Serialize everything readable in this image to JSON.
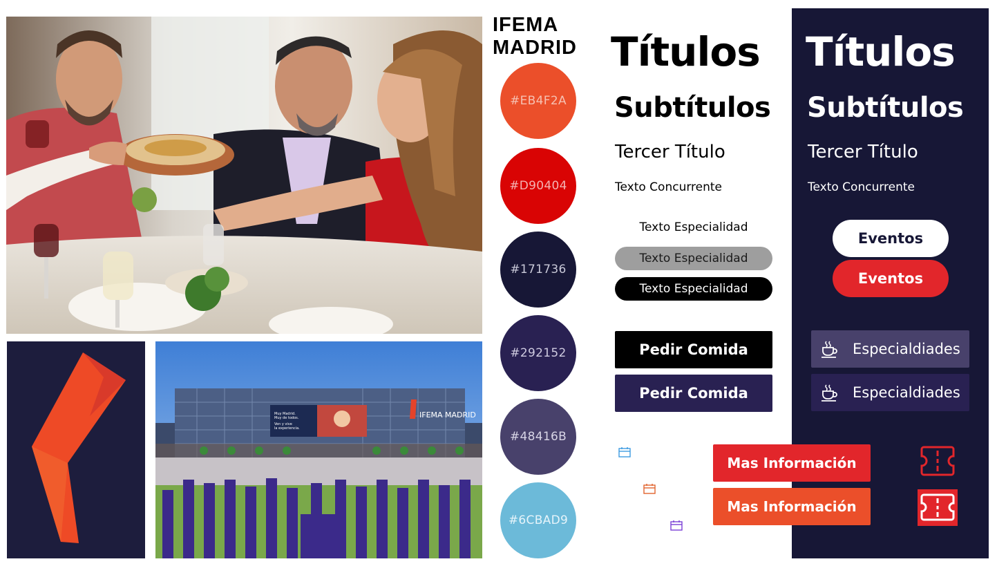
{
  "brand": {
    "line1": "IFEMA",
    "line2": "MADRID"
  },
  "swatches": [
    {
      "hex": "#EB4F2A",
      "label": "#EB4F2A"
    },
    {
      "hex": "#D90404",
      "label": "#D90404"
    },
    {
      "hex": "#171736",
      "label": "#171736"
    },
    {
      "hex": "#292152",
      "label": "#292152"
    },
    {
      "hex": "#48416B",
      "label": "#48416B"
    },
    {
      "hex": "#6CBAD9",
      "label": "#6CBAD9"
    }
  ],
  "light": {
    "title": "Títulos",
    "subtitle": "Subtítulos",
    "third_title": "Tercer Título",
    "body_text": "Texto Concurrente",
    "specialty_plain": "Texto Especialidad",
    "specialty_grey": "Texto Especialidad",
    "specialty_black": "Texto Especialidad",
    "order_black": "Pedir Comida",
    "order_purple": "Pedir Comida",
    "info_red": "Mas Información",
    "info_orange": "Mas Información"
  },
  "dark": {
    "title": "Títulos",
    "subtitle": "Subtítulos",
    "third_title": "Tercer Título",
    "body_text": "Texto Concurrente",
    "events_white": "Eventos",
    "events_red": "Eventos",
    "specialties_1": "Especialdiades",
    "specialties_2": "Especialdiades"
  },
  "building_sign": {
    "brand": "IFEMA MADRID",
    "banner_line1": "Muy Madrid.",
    "banner_line2": "Muy de todos.",
    "banner_line3": "Ven y vive",
    "banner_line4": "la experiencia."
  },
  "icons": {
    "calendar_blue": "calendar-icon",
    "calendar_orange": "calendar-icon",
    "calendar_purple": "calendar-icon",
    "coffee": "coffee-cup-icon",
    "ticket_outline": "ticket-icon",
    "ticket_filled": "ticket-icon"
  }
}
